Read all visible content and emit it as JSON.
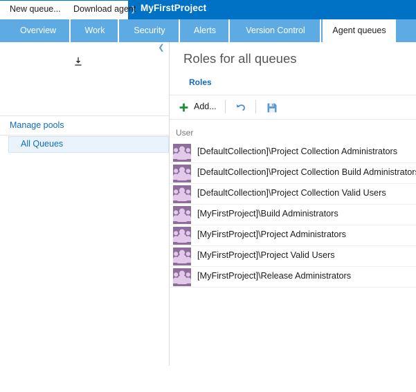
{
  "header": {
    "chevron_icon": "chevron-right-icon",
    "title": "MyFirstProject"
  },
  "tabs": [
    {
      "label": "Overview",
      "active": false
    },
    {
      "label": "Work",
      "active": false
    },
    {
      "label": "Security",
      "active": false
    },
    {
      "label": "Alerts",
      "active": false
    },
    {
      "label": "Version Control",
      "active": false
    },
    {
      "label": "Agent queues",
      "active": true
    }
  ],
  "left_panel": {
    "collapse_icon": "chevron-left-icon",
    "new_queue_label": "New queue...",
    "download_agent_label": "Download agent",
    "download_icon": "download-icon",
    "manage_pools_label": "Manage pools",
    "queues": [
      {
        "label": "All Queues",
        "selected": true
      }
    ]
  },
  "content": {
    "title": "Roles for all queues",
    "pivot_tab": "Roles",
    "toolbar": {
      "add_label": "Add...",
      "add_icon": "plus-icon",
      "undo_icon": "undo-icon",
      "save_icon": "save-icon"
    },
    "grid": {
      "columns": [
        "User"
      ],
      "rows": [
        {
          "avatar_icon": "group-avatar-icon",
          "user": "[DefaultCollection]\\Project Collection Administrators"
        },
        {
          "avatar_icon": "group-avatar-icon",
          "user": "[DefaultCollection]\\Project Collection Build Administrators"
        },
        {
          "avatar_icon": "group-avatar-icon",
          "user": "[DefaultCollection]\\Project Collection Valid Users"
        },
        {
          "avatar_icon": "group-avatar-icon",
          "user": "[MyFirstProject]\\Build Administrators"
        },
        {
          "avatar_icon": "group-avatar-icon",
          "user": "[MyFirstProject]\\Project Administrators"
        },
        {
          "avatar_icon": "group-avatar-icon",
          "user": "[MyFirstProject]\\Project Valid Users"
        },
        {
          "avatar_icon": "group-avatar-icon",
          "user": "[MyFirstProject]\\Release Administrators"
        }
      ]
    }
  },
  "colors": {
    "header_blue": "#0072c6",
    "tab_blue": "#5eaae2",
    "link_blue": "#0f6cbd",
    "add_green": "#1d8f3b",
    "icon_blue": "#5a9bd5",
    "avatar_purple": "#8d6e9a",
    "avatar_light": "#e2c9ea"
  }
}
